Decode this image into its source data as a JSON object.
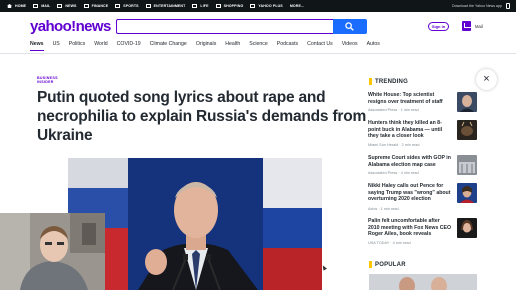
{
  "topbar": {
    "items": [
      {
        "label": "HOME",
        "icon": "home-icon"
      },
      {
        "label": "MAIL",
        "icon": "mail-icon"
      },
      {
        "label": "NEWS",
        "icon": "news-icon"
      },
      {
        "label": "FINANCE",
        "icon": "finance-icon"
      },
      {
        "label": "SPORTS",
        "icon": "sports-icon"
      },
      {
        "label": "ENTERTAINMENT",
        "icon": "entertainment-icon"
      },
      {
        "label": "LIFE",
        "icon": "life-icon"
      },
      {
        "label": "SHOPPING",
        "icon": "shopping-icon"
      },
      {
        "label": "YAHOO PLUS",
        "icon": "yahoo-plus-icon"
      },
      {
        "label": "MORE...",
        "icon": ""
      }
    ],
    "download_label": "Download the Yahoo News app"
  },
  "header": {
    "logo": "yahoo!news",
    "search_placeholder": "",
    "sign_in": "Sign in",
    "mail": "Mail",
    "brand_color": "#6001d2",
    "search_button_color": "#1a6dff"
  },
  "nav": {
    "tabs": [
      "News",
      "US",
      "Politics",
      "World",
      "COVID-19",
      "Climate Change",
      "Originals",
      "Health",
      "Science",
      "Podcasts",
      "Contact Us",
      "Videos",
      "Autos"
    ],
    "active": "News"
  },
  "article": {
    "eyebrow_line1": "BUSINESS",
    "eyebrow_line2": "INSIDER",
    "headline": "Putin quoted song lyrics about rape and necrophilia to explain Russia's demands from Ukraine"
  },
  "close_label": "×",
  "trending": {
    "title": "TRENDING",
    "items": [
      {
        "title": "White House: Top scientist resigns over treatment of staff",
        "source": "Associated Press · 1 min read"
      },
      {
        "title": "Hunters think they killed an 8-point buck in Alabama — until they take a closer look",
        "source": "Miami Sun Herald · 2 min read"
      },
      {
        "title": "Supreme Court sides with GOP in Alabama election map case",
        "source": "Associated Press · 4 min read"
      },
      {
        "title": "Nikki Haley calls out Pence for saying Trump was \"wrong\" about overturning 2020 election",
        "source": "Axios · 1 min read"
      },
      {
        "title": "Palin felt uncomfortable after 2010 meeting with Fox News CEO Roger Ailes, book reveals",
        "source": "USA TODAY · 4 min read"
      }
    ]
  },
  "popular": {
    "title": "POPULAR"
  }
}
